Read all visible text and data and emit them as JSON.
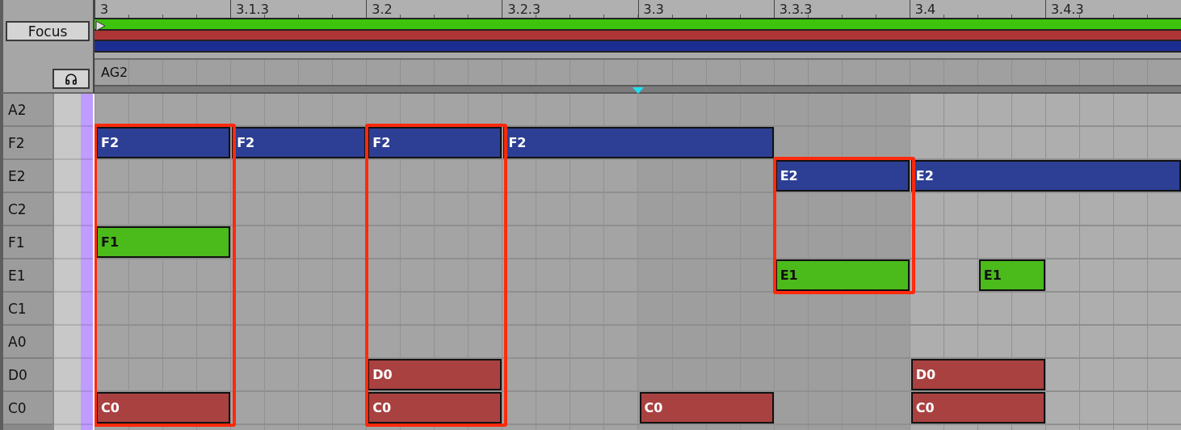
{
  "header": {
    "focus_button": "Focus",
    "clip_name": "AG2"
  },
  "ruler": [
    "3",
    "3.1.3",
    "3.2",
    "3.2.3",
    "3.3",
    "3.3.3",
    "3.4",
    "3.4.3"
  ],
  "clips": [
    {
      "color": "#3ec40c"
    },
    {
      "color": "#ae3535"
    },
    {
      "color": "#1c2d92"
    }
  ],
  "rows": [
    {
      "label": "A2",
      "notes": []
    },
    {
      "label": "F2",
      "notes": [
        {
          "kind": "eighth",
          "label": "F2",
          "color": "#2d3f94",
          "outlined": true
        },
        {
          "kind": "eighth",
          "label": "F2",
          "color": "#2d3f94",
          "outlined": false
        },
        {
          "kind": "eighth",
          "label": "F2",
          "color": "#2d3f94",
          "outlined": true
        },
        {
          "kind": "quarter",
          "label": "F2",
          "color": "#2d3f94",
          "outlined": false
        }
      ]
    },
    {
      "label": "E2",
      "notes": [
        {
          "kind": "half_rest"
        },
        {
          "kind": "eighth_rest"
        },
        {
          "kind": "eighth",
          "label": "E2",
          "color": "#2d3f94",
          "outlined": true
        },
        {
          "kind": "quarter",
          "label": "E2",
          "color": "#2d3f94",
          "outlined": false
        }
      ]
    },
    {
      "label": "C2",
      "notes": []
    },
    {
      "label": "F1",
      "notes": [
        {
          "kind": "eighth",
          "label": "F1",
          "color": "#4bba1b",
          "outlined": true
        }
      ]
    },
    {
      "label": "E1",
      "notes": [
        {
          "kind": "half_rest"
        },
        {
          "kind": "eighth_rest"
        },
        {
          "kind": "eighth",
          "label": "E1",
          "color": "#4bba1b",
          "outlined": true
        },
        {
          "kind": "sixteenth_rest"
        },
        {
          "kind": "sixteenth",
          "label": "E1",
          "color": "#4bba1b",
          "outlined": false
        }
      ]
    },
    {
      "label": "C1",
      "notes": []
    },
    {
      "label": "A0",
      "notes": []
    },
    {
      "label": "D0",
      "notes": [
        {
          "kind": "quarter_rest"
        },
        {
          "kind": "eighth",
          "label": "D0",
          "color": "#a94141",
          "outlined": true
        },
        {
          "kind": "quarter_rest"
        },
        {
          "kind": "eighth_rest"
        },
        {
          "kind": "eighth",
          "label": "D0",
          "color": "#a94141",
          "outlined": false
        }
      ]
    },
    {
      "label": "C0",
      "notes": [
        {
          "kind": "eighth",
          "label": "C0",
          "color": "#a94141",
          "outlined": true
        },
        {
          "kind": "eighth_rest"
        },
        {
          "kind": "eighth",
          "label": "C0",
          "color": "#a94141",
          "outlined": true
        },
        {
          "kind": "eighth_rest"
        },
        {
          "kind": "eighth",
          "label": "C0",
          "color": "#a94141",
          "outlined": false
        },
        {
          "kind": "eighth_rest"
        },
        {
          "kind": "eighth",
          "label": "C0",
          "color": "#a94141",
          "outlined": false
        }
      ]
    }
  ]
}
